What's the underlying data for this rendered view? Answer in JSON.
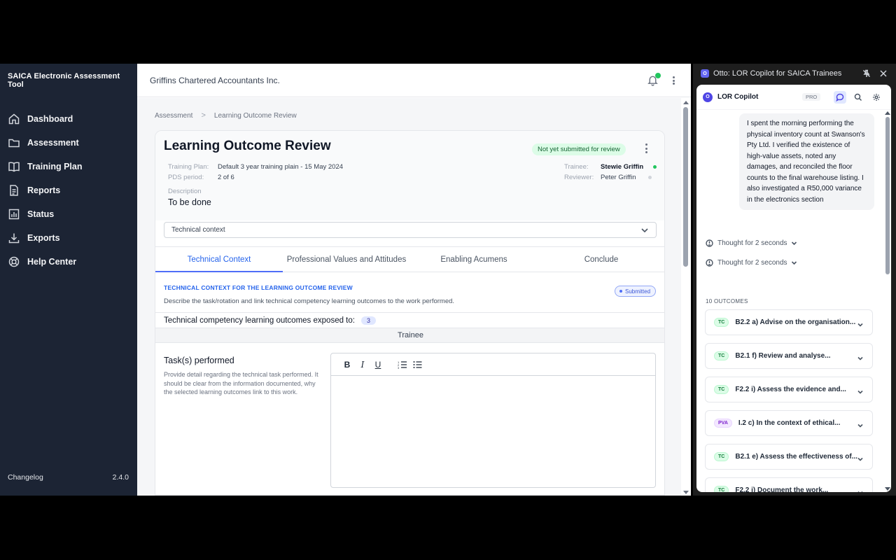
{
  "sidebar": {
    "brand": "SAICA Electronic Assessment Tool",
    "items": [
      {
        "label": "Dashboard",
        "icon": "home-icon"
      },
      {
        "label": "Assessment",
        "icon": "folder-icon"
      },
      {
        "label": "Training Plan",
        "icon": "book-icon"
      },
      {
        "label": "Reports",
        "icon": "report-icon"
      },
      {
        "label": "Status",
        "icon": "bar-chart-icon"
      },
      {
        "label": "Exports",
        "icon": "download-icon"
      },
      {
        "label": "Help Center",
        "icon": "lifebuoy-icon"
      }
    ],
    "changelog": "Changelog",
    "version": "2.4.0"
  },
  "topbar": {
    "org": "Griffins Chartered Accountants Inc."
  },
  "breadcrumb": {
    "root": "Assessment",
    "sep": ">",
    "current": "Learning Outcome Review"
  },
  "review": {
    "title": "Learning Outcome Review",
    "status": "Not yet submitted for review",
    "training_plan_label": "Training Plan:",
    "training_plan_value": "Default 3 year training plain - 15 May 2024",
    "pds_label": "PDS period:",
    "pds_value": "2 of 6",
    "trainee_label": "Trainee:",
    "trainee_value": "Stewie Griffin",
    "reviewer_label": "Reviewer:",
    "reviewer_value": "Peter Griffin",
    "description_label": "Description",
    "description_value": "To be done",
    "section_select": "Technical context"
  },
  "tabs": [
    {
      "label": "Technical Context"
    },
    {
      "label": "Professional Values and Attitudes"
    },
    {
      "label": "Enabling Acumens"
    },
    {
      "label": "Conclude"
    }
  ],
  "technical": {
    "heading": "TECHNICAL CONTEXT FOR THE LEARNING OUTCOME REVIEW",
    "subtitle": "Describe the task/rotation and link technical competency learning outcomes to the work performed.",
    "badge": "Submitted",
    "exposed_label": "Technical competency learning outcomes exposed to:",
    "exposed_count": "3",
    "trainee_bar": "Trainee",
    "task_title": "Task(s) performed",
    "task_help": "Provide detail regarding the technical task performed. It should be clear from the information documented, why the selected learning outcomes link to this work."
  },
  "editor_toolbar": {
    "bold": "B",
    "italic": "I",
    "underline": "U"
  },
  "copilot": {
    "window_title": "Otto: LOR Copilot for SAICA Trainees",
    "window_logo": "O",
    "name": "LOR Copilot",
    "avatar": "O",
    "badge": "PRO",
    "message": "I spent the morning performing the physical inventory count at Swanson's Pty Ltd. I verified the existence of high-value assets, noted any damages, and reconciled the floor counts to the final warehouse listing. I also investigated a R50,000 variance in the electronics section",
    "thoughts": [
      "Thought for 2 seconds",
      "Thought for 2 seconds"
    ],
    "outcomes_label": "10 OUTCOMES",
    "outcomes": [
      {
        "tag": "TC",
        "text": "B2.2 a) Advise on the organisation..."
      },
      {
        "tag": "TC",
        "text": "B2.1 f) Review and analyse..."
      },
      {
        "tag": "TC",
        "text": "F2.2 i) Assess the evidence and..."
      },
      {
        "tag": "PVA",
        "text": "I.2 c) In the context of ethical..."
      },
      {
        "tag": "TC",
        "text": "B2.1 e) Assess the effectiveness of..."
      },
      {
        "tag": "TC",
        "text": "F2.2 j) Document the work..."
      }
    ]
  },
  "colors": {
    "sidebar_bg": "#1c2434",
    "accent": "#4f6ef7",
    "status_green": "#22c55e"
  }
}
